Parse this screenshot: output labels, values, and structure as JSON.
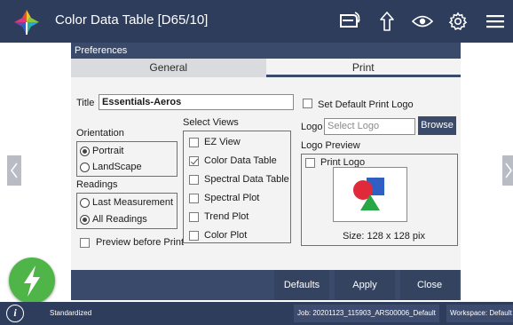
{
  "app": {
    "title": "Color Data Table [D65/10]",
    "icons": [
      "app-logo-icon",
      "device-sync-icon",
      "upload-arrow-icon",
      "eye-icon",
      "gear-icon",
      "menu-icon"
    ]
  },
  "dialog": {
    "title": "Preferences",
    "tabs": [
      {
        "label": "General",
        "active": false
      },
      {
        "label": "Print",
        "active": true
      }
    ],
    "print": {
      "title_label": "Title",
      "title_value": "Essentials-Aeros",
      "orientation": {
        "label": "Orientation",
        "options": [
          {
            "label": "Portrait",
            "selected": true
          },
          {
            "label": "LandScape",
            "selected": false
          }
        ]
      },
      "readings": {
        "label": "Readings",
        "options": [
          {
            "label": "Last Measurement",
            "selected": false
          },
          {
            "label": "All Readings",
            "selected": true
          }
        ]
      },
      "preview_before_print": {
        "label": "Preview before Print",
        "checked": false
      },
      "select_views": {
        "label": "Select Views",
        "items": [
          {
            "label": "EZ View",
            "checked": false
          },
          {
            "label": "Color Data Table",
            "checked": true
          },
          {
            "label": "Spectral Data Table",
            "checked": false
          },
          {
            "label": "Spectral Plot",
            "checked": false
          },
          {
            "label": "Trend Plot",
            "checked": false
          },
          {
            "label": "Color Plot",
            "checked": false
          }
        ]
      },
      "set_default_logo": {
        "label": "Set Default Print Logo",
        "checked": false
      },
      "logo": {
        "label": "Logo",
        "placeholder": "Select Logo",
        "browse_label": "Browse"
      },
      "logo_preview": {
        "label": "Logo Preview",
        "print_logo": {
          "label": "Print Logo",
          "checked": false
        },
        "size_text": "Size: 128 x 128 pix"
      }
    },
    "buttons": {
      "defaults": "Defaults",
      "apply": "Apply",
      "close": "Close"
    }
  },
  "status": {
    "mode": "Standardized",
    "job": "Job: 20201123_115903_ARS00006_Default",
    "workspace": "Workspace: Default"
  },
  "colors": {
    "bar": "#2e3d5c",
    "dialog_frame": "#3a4a6b",
    "fab": "#4fb548"
  }
}
